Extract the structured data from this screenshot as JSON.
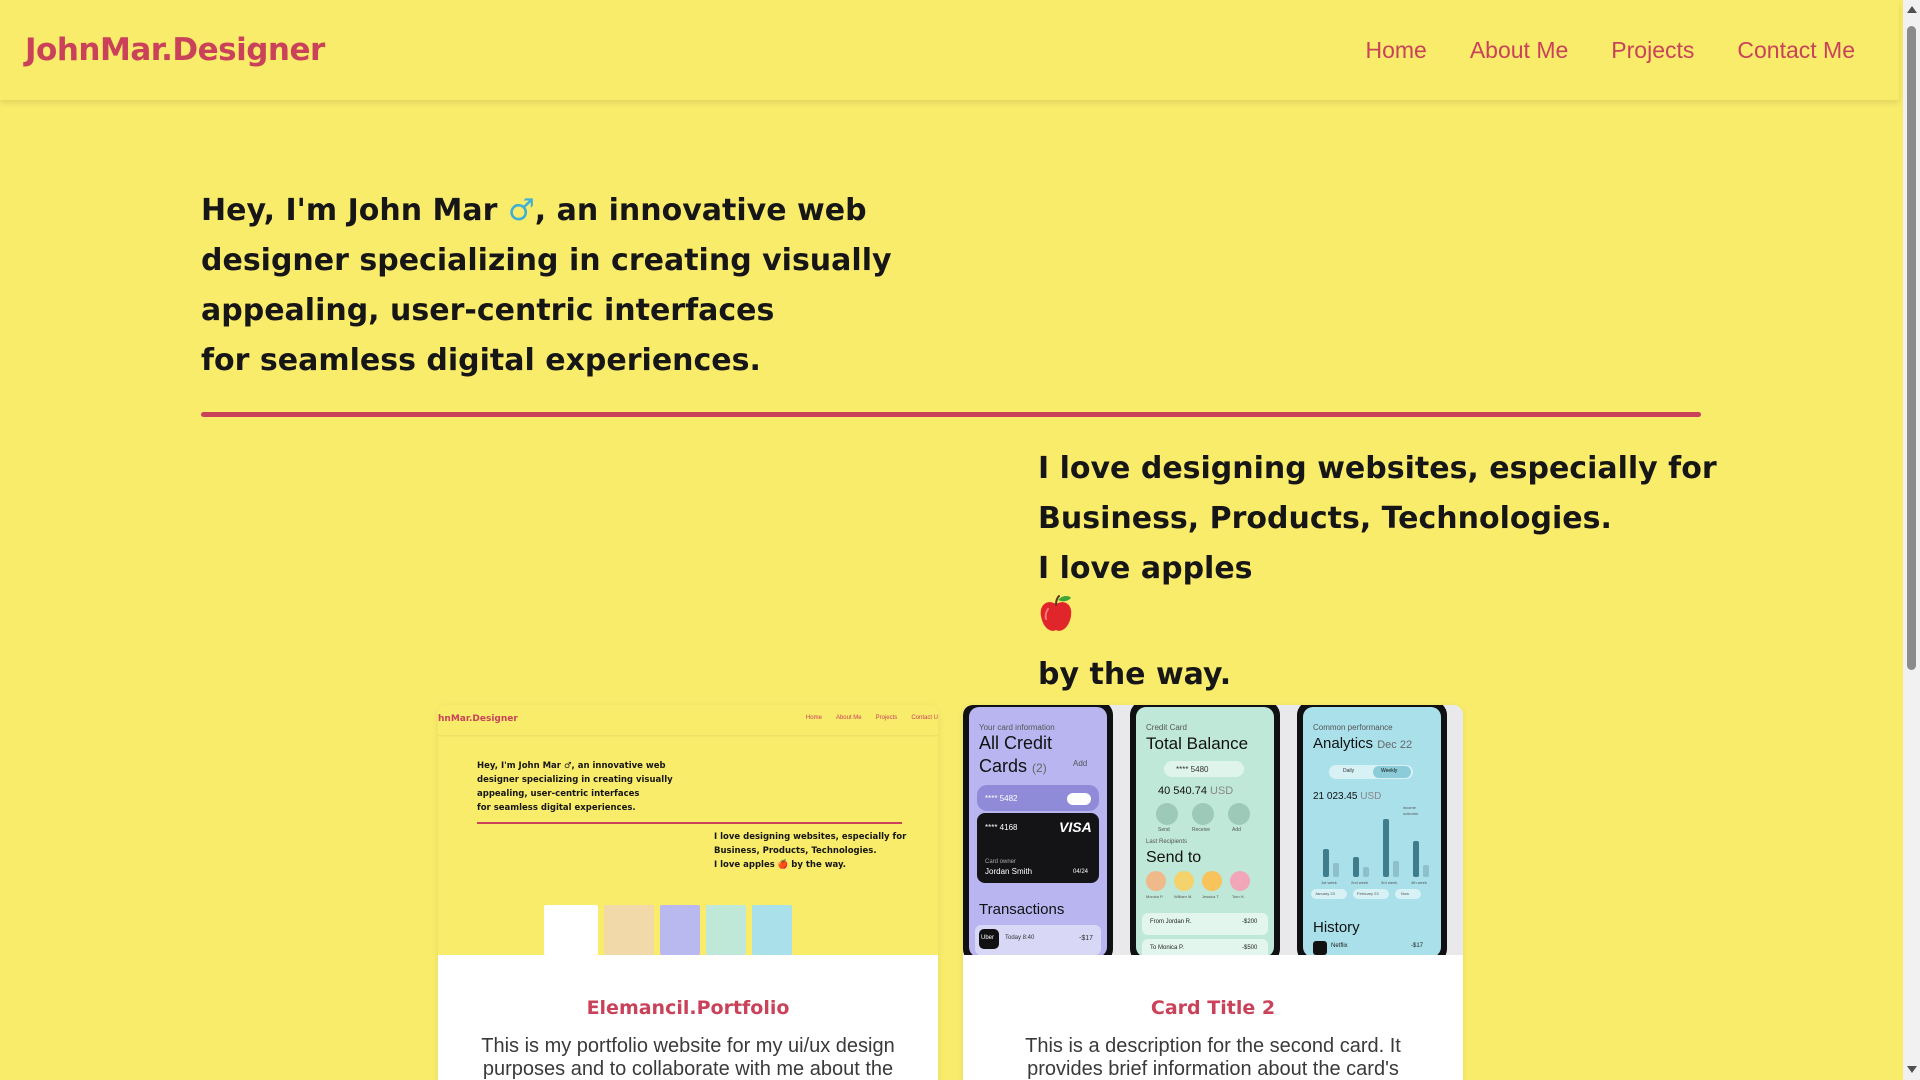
{
  "navbar": {
    "logo": "JohnMar.Designer",
    "links": [
      "Home",
      "About Me",
      "Projects",
      "Contact Me"
    ]
  },
  "hero": {
    "line1_a": "Hey, I'm John Mar ",
    "male_sign": "♂",
    "line1_b": ", an innovative web",
    "line2": "designer specializing in creating visually",
    "line3": "appealing, user-centric interfaces",
    "line4": "for seamless digital experiences."
  },
  "about": {
    "line1": "I love designing websites, especially for",
    "line2": "Business, Products, Technologies.",
    "line3_a": "I love apples ",
    "line3_b": " by the way."
  },
  "cards": [
    {
      "title": "Elemancil.Portfolio",
      "description": "This is my portfolio website for my ui/ux design purposes and to collaborate with me about the"
    },
    {
      "title": "Card Title 2",
      "description": "This is a description for the second card. It provides brief information about the card's content."
    }
  ],
  "thumbnail": {
    "logo": "hnMar.Designer",
    "links": [
      "Home",
      "About Me",
      "Projects",
      "Contact U"
    ],
    "hero": [
      "Hey, I'm John Mar ♂, an innovative web",
      "designer specializing in creating visually",
      "appealing, user-centric interfaces",
      "for seamless digital experiences."
    ],
    "love": [
      "I love designing websites, especially for",
      "Business, Products, Technologies.",
      "I love apples 🍎 by the way."
    ]
  },
  "phones": {
    "p1": {
      "label": "Your card information",
      "title_a": "All Credit",
      "title_b": "Cards",
      "count": "(2)",
      "add": "Add",
      "card1_num": "**** 5482",
      "card2_num": "**** 4168",
      "card2_brand": "VISA",
      "card_owner_label": "Card owner",
      "card_owner": "Jordan Smith",
      "expiry": "04/24",
      "section": "Transactions",
      "merchant": "Uber",
      "merchant_date": "Today 8:40",
      "amount": "-$17"
    },
    "p2": {
      "label": "Credit Card",
      "title": "Total Balance",
      "card_num": "**** 5480",
      "balance": "40 540.74",
      "currency": "USD",
      "actions": [
        "Send",
        "Receive",
        "Add"
      ],
      "recipients_label": "Last Recipients",
      "send_to": "Send to",
      "names": [
        "Monica P.",
        "William M.",
        "Jessica T.",
        "Tom H."
      ],
      "row1_name": "From Jordan R.",
      "row1_amount": "-$200",
      "row2_name": "To Monica P.",
      "row2_amount": "-$500"
    },
    "p3": {
      "label": "Common performance",
      "title": "Analytics",
      "date": "Dec 22",
      "tabs": [
        "Daily",
        "Weekly"
      ],
      "value": "21 023.45",
      "currency": "USD",
      "legend": [
        "income",
        "outcome"
      ],
      "days": [
        "1st week",
        "2nd week",
        "3rd week",
        "4th week"
      ],
      "filters": [
        "January 23",
        "February 23",
        "Now"
      ],
      "history": "History",
      "merchant": "Netflix",
      "amount": "-$17"
    }
  },
  "colors": {
    "background": "#f9ec6b",
    "accent": "#c9425a",
    "text": "#161616"
  }
}
